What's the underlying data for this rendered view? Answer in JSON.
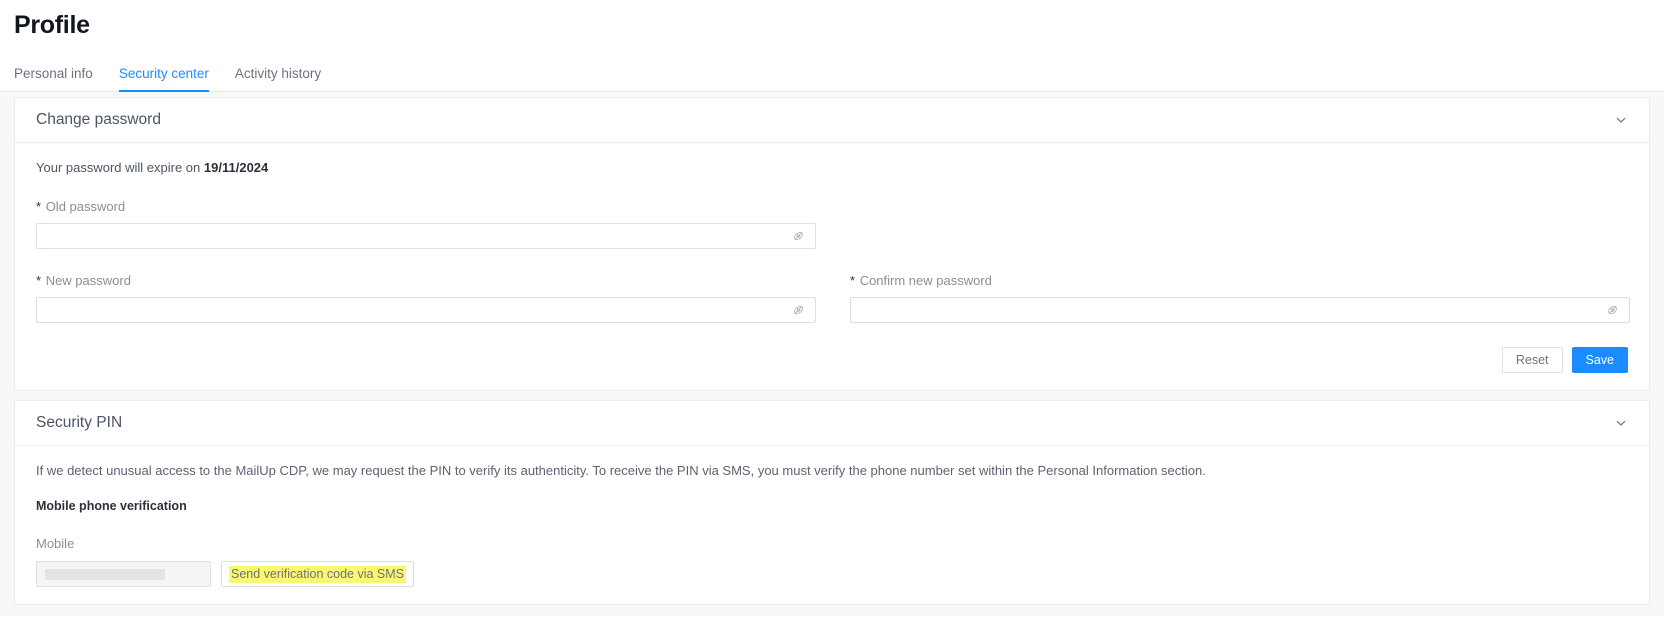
{
  "header": {
    "title": "Profile"
  },
  "tabs": [
    {
      "label": "Personal info",
      "active": false
    },
    {
      "label": "Security center",
      "active": true
    },
    {
      "label": "Activity history",
      "active": false
    }
  ],
  "change_password": {
    "title": "Change password",
    "collapse_icon": "chevron-down-icon",
    "expire_prefix": "Your password will expire on",
    "expire_date": "19/11/2024",
    "fields": {
      "old": {
        "required_mark": "*",
        "label": "Old password",
        "value": "",
        "placeholder": "",
        "reveal_icon": "eye-off-icon"
      },
      "new": {
        "required_mark": "*",
        "label": "New password",
        "value": "",
        "placeholder": "",
        "reveal_icon": "eye-off-icon"
      },
      "confirm": {
        "required_mark": "*",
        "label": "Confirm new password",
        "value": "",
        "placeholder": "",
        "reveal_icon": "eye-off-icon"
      }
    },
    "buttons": {
      "reset": "Reset",
      "save": "Save"
    }
  },
  "security_pin": {
    "title": "Security PIN",
    "collapse_icon": "chevron-down-icon",
    "description": "If we detect unusual access to the MailUp CDP, we may request the PIN to verify its authenticity. To receive the PIN via SMS, you must verify the phone number set within the Personal Information section.",
    "subheading": "Mobile phone verification",
    "mobile_label": "Mobile",
    "mobile_value": "",
    "send_sms_label": "Send verification code via SMS"
  },
  "colors": {
    "accent": "#1a8cff",
    "page_bg": "#f7f8f9",
    "card_border": "#ebedef",
    "highlight": "#fbf773",
    "text_muted": "#8a8f98"
  }
}
